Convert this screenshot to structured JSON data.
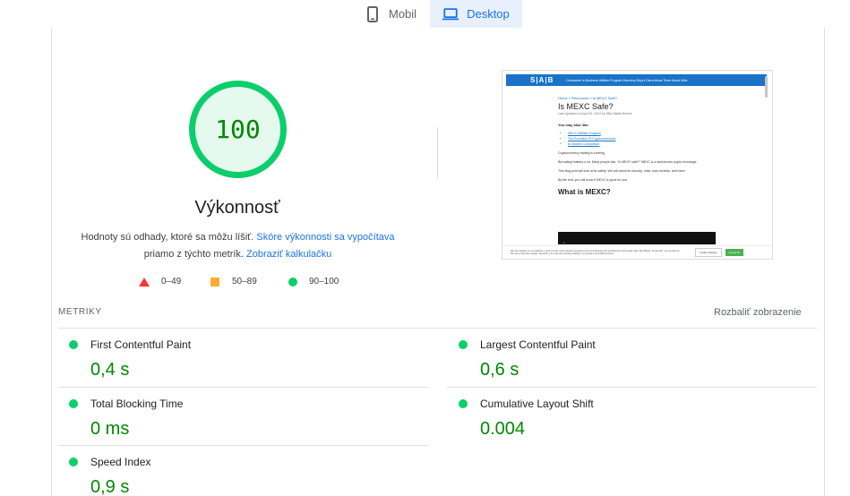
{
  "tabs": [
    {
      "label": "Mobil",
      "icon": "phone-icon",
      "active": false
    },
    {
      "label": "Desktop",
      "icon": "laptop-icon",
      "active": true
    }
  ],
  "score": {
    "value": "100",
    "title": "Výkonnosť",
    "desc_prefix": "Hodnoty sú odhady, ktoré sa môžu líšiť.",
    "desc_link1": "Skóre výkonnosti sa vypočítava",
    "desc_mid": "priamo z týchto metrík.",
    "desc_link2": "Zobraziť kalkulačku",
    "color": "#0cce6b"
  },
  "legend": [
    {
      "range": "0–49",
      "shape": "triangle",
      "color": "#ff3333"
    },
    {
      "range": "50–89",
      "shape": "square",
      "color": "#ffaa33"
    },
    {
      "range": "90–100",
      "shape": "circle",
      "color": "#0cce6b"
    }
  ],
  "screenshot": {
    "logo": "S|A|B",
    "nav": "Guarantee to Business     Affiliate Program Directory     Blog ▾     Discontinue Timer     About Mike",
    "crumb": "Home » Resources » Is MEXC Safe?",
    "title": "Is MEXC Safe?",
    "meta": "Last Updated on April 29, 2024 by Mike Battle-Behrel",
    "also_like": "You may also like:",
    "links": [
      "MEXC Affiliate Program",
      "The Evolution Of Cryptocurrencies",
      "AI Models Comparison"
    ],
    "p1": "Cryptocurrency trading is exciting.",
    "p2": "But safety matters a lot. Many people ask, \"Is MEXC safe?\" MEXC is a well-known crypto exchange.",
    "p3": "This blog post will look at its safety. We will check its security, rules, user reviews, and more.",
    "p4": "By the end, you will know if MEXC is good for you.",
    "h2": "What is MEXC?",
    "cookie_text": "We use cookies on our website to give you the most relevant experience by remembering your preferences and repeat visits. By clicking \"Accept All\", you consent to the use of ALL the cookies. However, you may visit \"Cookie Settings\" to provide a controlled consent.",
    "cookie_settings": "Cookie Settings",
    "cookie_accept": "Accept All"
  },
  "metrics": {
    "header": "METRIKY",
    "expand": "Rozbaliť zobrazenie",
    "items": [
      {
        "name": "First Contentful Paint",
        "value": "0,4 s"
      },
      {
        "name": "Largest Contentful Paint",
        "value": "0,6 s"
      },
      {
        "name": "Total Blocking Time",
        "value": "0 ms"
      },
      {
        "name": "Cumulative Layout Shift",
        "value": "0.004"
      },
      {
        "name": "Speed Index",
        "value": "0,9 s"
      }
    ],
    "good_color": "#0cce6b",
    "value_color": "#008800"
  }
}
